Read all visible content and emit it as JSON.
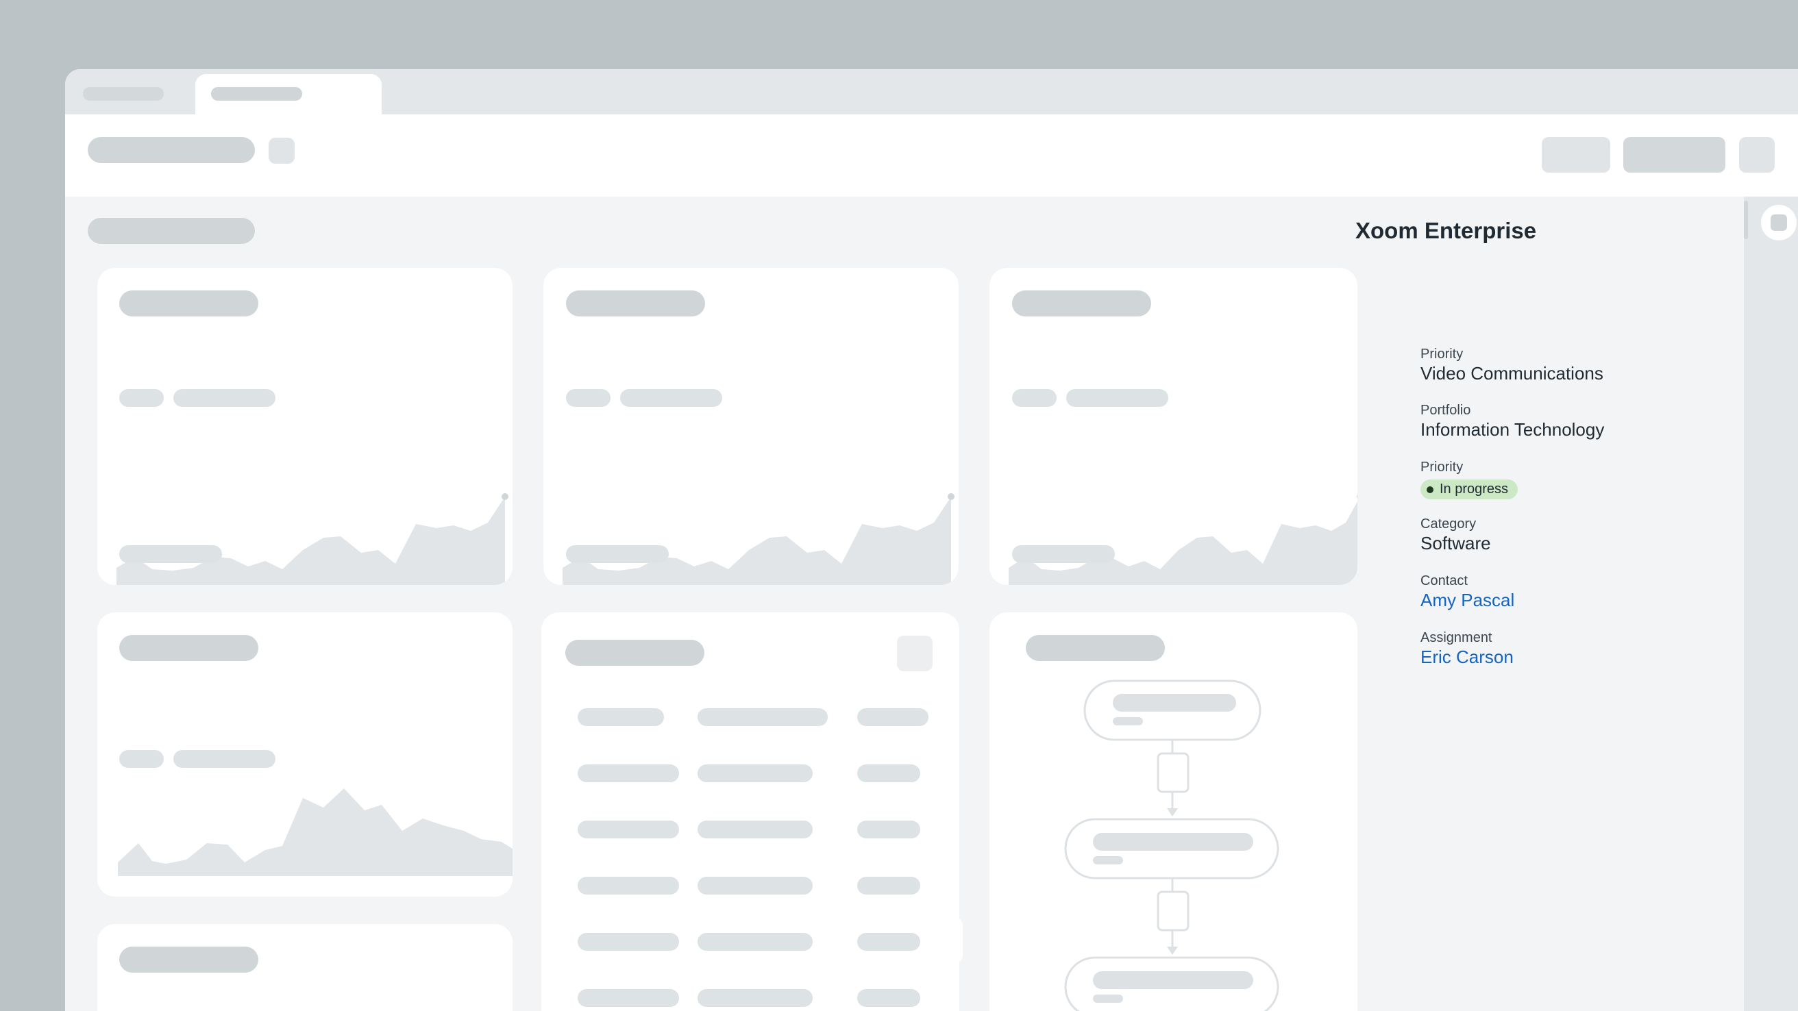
{
  "details": {
    "title": "Xoom Enterprise",
    "fields": [
      {
        "label": "Priority",
        "value": "Video Communications"
      },
      {
        "label": "Portfolio",
        "value": "Information Technology"
      },
      {
        "label": "Priority",
        "value": "In progress"
      },
      {
        "label": "Category",
        "value": "Software"
      },
      {
        "label": "Contact",
        "value": "Amy Pascal"
      },
      {
        "label": "Assignment",
        "value": "Eric Carson"
      }
    ]
  },
  "colors": {
    "link": "#1565c0",
    "badge_bg": "#cde8c5",
    "placeholder": "#d0d5d8",
    "chart_fill": "#e2e5e8"
  },
  "icons": [
    "panel-toggle-icon"
  ]
}
